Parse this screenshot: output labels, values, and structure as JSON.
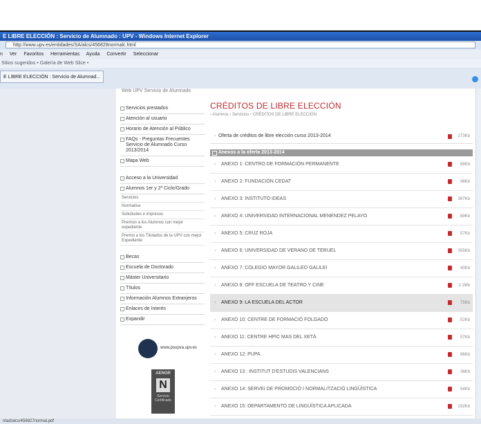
{
  "window": {
    "title": "E LIBRE ELECCIÓN : Servicio de Alumnado : UPV - Windows Internet Explorer",
    "address": "http://www.upv.es/entidades/SA/alcs/456828normalc.html",
    "menu": [
      "n",
      "Ver",
      "Favoritos",
      "Herramientas",
      "Ayuda",
      "Convertir",
      "Seleccionar"
    ],
    "favorites": "Sitios sugeridos • Galería de Web Slice •",
    "tab_label": "E LIBRE ELECCIÓN : Servicio de Alumnad...",
    "status": "ntad/alcs/456827normal.pdf"
  },
  "topnav": "Web UPV  Servicio de Alumnado",
  "sidebar": {
    "items_a": [
      "Servicios prestados",
      "Atención al usuario",
      "Horario de Atención al Público",
      "FAQs - Preguntas Frecuentes Servicio de Alumnado Curso 2013/2014",
      "Mapa Web"
    ],
    "items_b": [
      "Acceso a la Universidad",
      "Alumnos 1er y 2º Ciclo/Grado"
    ],
    "sub": [
      "Servicios",
      "Normativa",
      "Solicitudes e impresos",
      "Premios a los Alumnos con mejor expediente",
      "Premio a los Titulados de la UPV con mejor Expediente"
    ],
    "items_c": [
      "Becas",
      "Escuela de Doctorado",
      "Máster Universitario",
      "Títulos",
      "Información Alumnos Extranjeros",
      "Enlaces de Interés",
      "Expandir"
    ],
    "logo_text": "www.poupva.upv.es",
    "aenor": {
      "title": "AENOR",
      "letter": "N",
      "sub": "Servicio Certificado"
    }
  },
  "main": {
    "title": "CRÉDITOS DE LIBRE ELECCIÓN",
    "breadcrumb": "› Alumnos › Servicios › CRÉDITOS DE LIBRE ELECCIÓN",
    "offer": {
      "label": "Oferta de créditos de libre elección curso 2013-2014",
      "size": "273Kb"
    },
    "section": "Anexos a la oferta 2013-2014",
    "annexes": [
      {
        "label": "ANEXO 1: CENTRO DE FORMACIÓN PERMANENTE",
        "size": "88Kb"
      },
      {
        "label": "ANEXO 2: FUNDACIÓN CEDAT",
        "size": "48Kb"
      },
      {
        "label": "ANEXO 3: INSTITUTO IDEAS",
        "size": "397Kb"
      },
      {
        "label": "ANEXO 4: UNIVERSIDAD INTERNACIONAL MENENDEZ PELAYO",
        "size": "89Kb"
      },
      {
        "label": "ANEXO 5: CRUZ ROJA",
        "size": "57Kb"
      },
      {
        "label": "ANEXO 6: UNIVERSIDAD DE VERANO DE TERUEL",
        "size": "355Kb"
      },
      {
        "label": "ANEXO 7: COLEGIO MAYOR GALILEO GALILEI",
        "size": "40Kb"
      },
      {
        "label": "ANEXO 8: OFF ESCUELA DE TEATRO Y CINE",
        "size": "2.1Mb"
      },
      {
        "label": "ANEXO 9: LA ESCUELA DEL ACTOR",
        "size": "75Kb"
      },
      {
        "label": "ANEXO 10: CENTRE DE FORMACIÓ FOLGADO",
        "size": "52Kb"
      },
      {
        "label": "ANEXO 11: CENTRE HPIC MAS DEL XETÀ",
        "size": "57Kb"
      },
      {
        "label": "ANEXO 12: PUPA",
        "size": "96Kb"
      },
      {
        "label": "ANEXO 13 : INSTITUT D'ESTUDIS VALENCIANS",
        "size": "38Kb"
      },
      {
        "label": "ANEXO 14: SERVEI DE PROMOCIÓ I NORMALITZACIÓ LINGÜÍSTICA",
        "size": "54Kb"
      },
      {
        "label": "ANEXO 15: DEPARTAMENTO DE LINGÜÍSTICA APLICADA",
        "size": "232Kb"
      }
    ],
    "highlighted_index": 8
  }
}
